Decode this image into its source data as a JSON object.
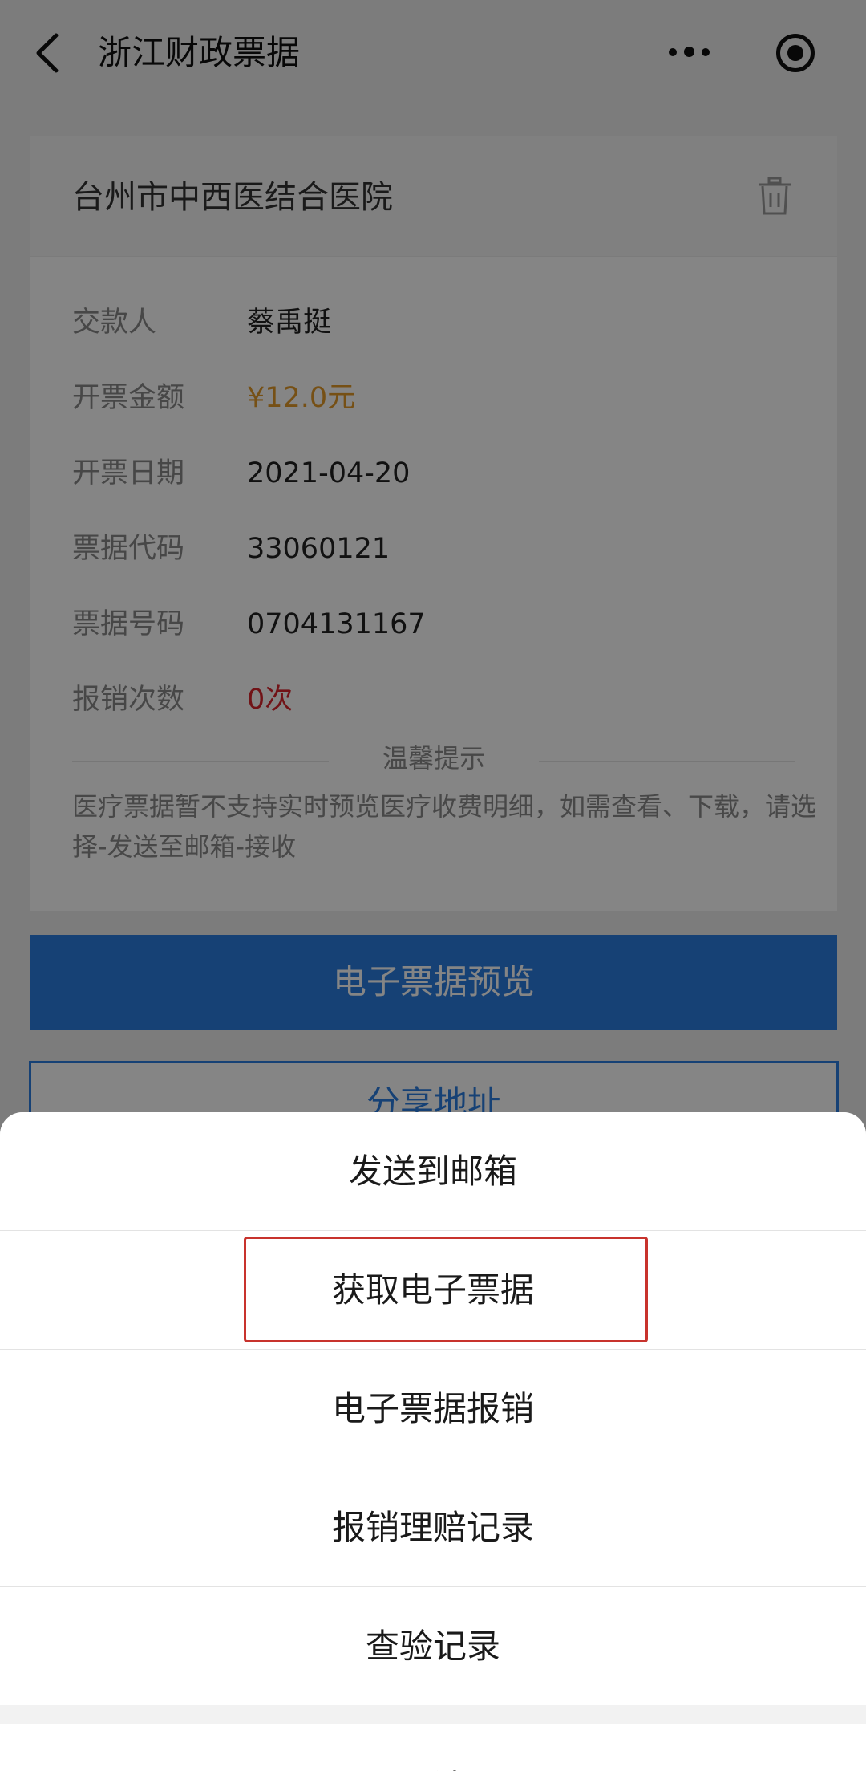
{
  "nav": {
    "title": "浙江财政票据",
    "back_icon": "chevron-left-icon",
    "more_icon": "more-dots-icon",
    "target_icon": "record-target-icon"
  },
  "card": {
    "hospital": "台州市中西医结合医院",
    "delete_icon": "trash-icon",
    "fields": [
      {
        "label": "交款人",
        "value": "蔡禹挺"
      },
      {
        "label": "开票金额",
        "value": "¥12.0元"
      },
      {
        "label": "开票日期",
        "value": "2021-04-20"
      },
      {
        "label": "票据代码",
        "value": "33060121"
      },
      {
        "label": "票据号码",
        "value": "0704131167"
      },
      {
        "label": "报销次数",
        "value": "0次"
      }
    ],
    "tip_title": "温馨提示",
    "tip_text": "医疗票据暂不支持实时预览医疗收费明细，如需查看、下载，请选择-发送至邮箱-接收"
  },
  "buttons": {
    "preview": "电子票据预览",
    "share": "分享地址"
  },
  "sheet": {
    "items": [
      "发送到邮箱",
      "获取电子票据",
      "电子票据报销",
      "报销理赔记录",
      "查验记录"
    ],
    "cancel": "取消"
  },
  "colors": {
    "accent_blue": "#2b7de0",
    "amount_orange": "#e39a2a",
    "count_red": "#d9262c",
    "highlight_red": "#c8332d"
  }
}
